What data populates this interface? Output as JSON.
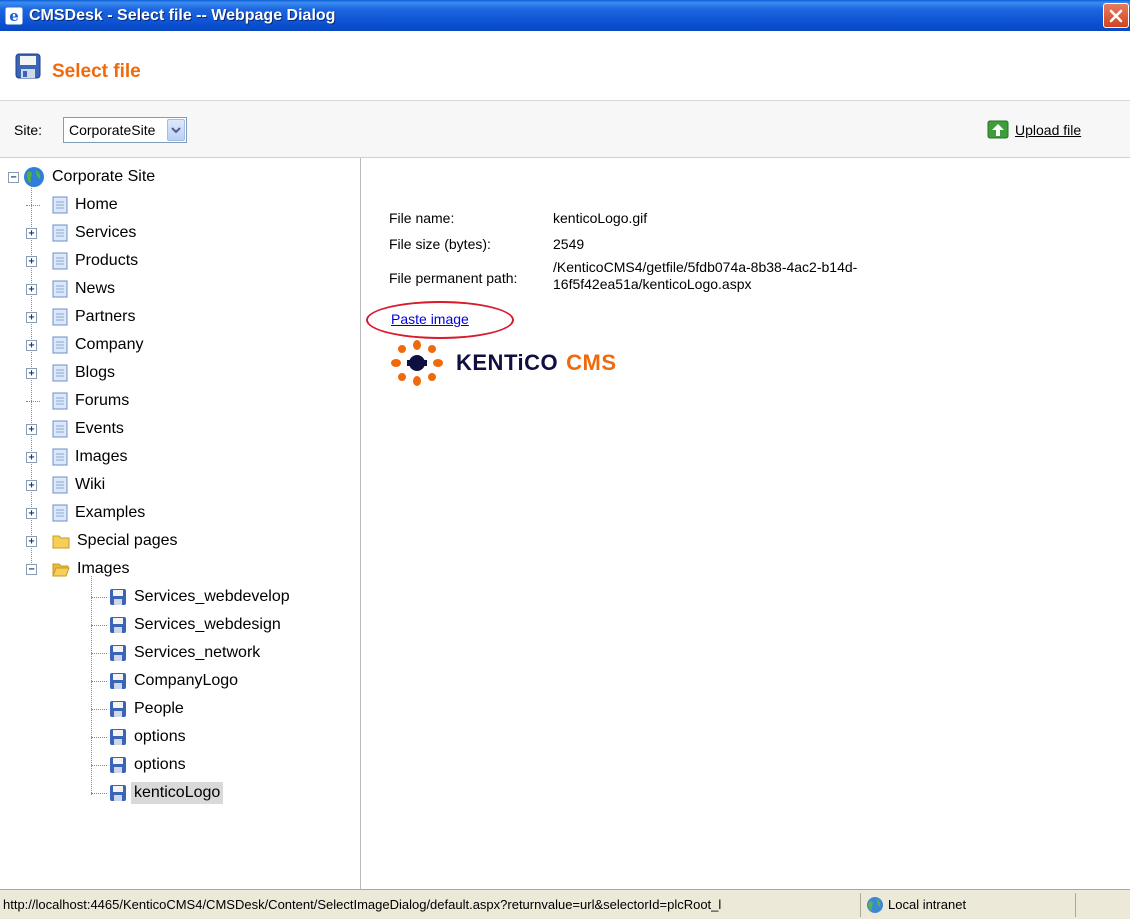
{
  "window": {
    "title": "CMSDesk - Select file -- Webpage Dialog"
  },
  "header": {
    "title": "Select file"
  },
  "toolbar": {
    "site_label": "Site:",
    "site_value": "CorporateSite",
    "upload_label": "Upload file"
  },
  "tree": {
    "root": "Corporate Site",
    "items": [
      "Home",
      "Services",
      "Products",
      "News",
      "Partners",
      "Company",
      "Blogs",
      "Forums",
      "Events",
      "Images",
      "Wiki",
      "Examples",
      "Special pages",
      "Images"
    ],
    "children": [
      "Services_webdevelop",
      "Services_webdesign",
      "Services_network",
      "CompanyLogo",
      "People",
      "options",
      "options",
      "kenticoLogo"
    ]
  },
  "file": {
    "name_label": "File name:",
    "name_value": "kenticoLogo.gif",
    "size_label": "File size (bytes):",
    "size_value": "2549",
    "path_label": "File permanent path:",
    "path_line1": "/KenticoCMS4/getfile/5fdb074a-8b38-4ac2-b14d-",
    "path_line2": "16f5f42ea51a/kenticoLogo.aspx",
    "paste_label": "Paste image"
  },
  "logo": {
    "text_main": "KENTiCO",
    "text_accent": "CMS"
  },
  "status": {
    "url": "http://localhost:4465/KenticoCMS4/CMSDesk/Content/SelectImageDialog/default.aspx?returnvalue=url&selectorId=plcRoot_l",
    "zone": "Local intranet"
  },
  "colors": {
    "title_bar": "#0a4fd0",
    "accent_orange": "#f06a0c",
    "link_blue": "#0000e0",
    "highlight_red": "#d9182c"
  }
}
